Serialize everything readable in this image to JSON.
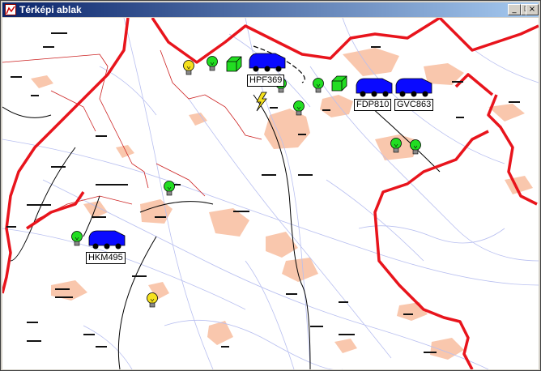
{
  "window": {
    "title": "Térképi ablak",
    "controls": {
      "minimize": "_",
      "maximize": "□",
      "close": "×"
    }
  },
  "map": {
    "colors": {
      "border": "#e8141c",
      "settlement": "#f9c7ad",
      "road": "#b8bff0",
      "rail": "#000000",
      "thin_border": "#cc2020"
    },
    "vehicles": [
      {
        "plate": "HPF369",
        "icon": "truck-icon",
        "color": "#0a0aff"
      },
      {
        "plate": "FDP810",
        "icon": "truck-icon",
        "color": "#0a0aff"
      },
      {
        "plate": "GVC863",
        "icon": "truck-icon",
        "color": "#0a0aff"
      },
      {
        "plate": "HKM495",
        "icon": "truck-icon",
        "color": "#0a0aff"
      }
    ],
    "bulbs": [
      {
        "state": "on",
        "color": "#22dd22"
      },
      {
        "state": "on",
        "color": "#22dd22"
      },
      {
        "state": "on",
        "color": "#22dd22"
      },
      {
        "state": "on",
        "color": "#22dd22"
      },
      {
        "state": "on",
        "color": "#22dd22"
      },
      {
        "state": "on",
        "color": "#22dd22"
      },
      {
        "state": "on",
        "color": "#22dd22"
      },
      {
        "state": "on",
        "color": "#22dd22"
      },
      {
        "state": "warning",
        "color": "#f5e11e"
      },
      {
        "state": "warning",
        "color": "#f5e11e"
      }
    ],
    "alarm": {
      "icon": "lightning-icon",
      "color": "#f5e11e"
    }
  }
}
